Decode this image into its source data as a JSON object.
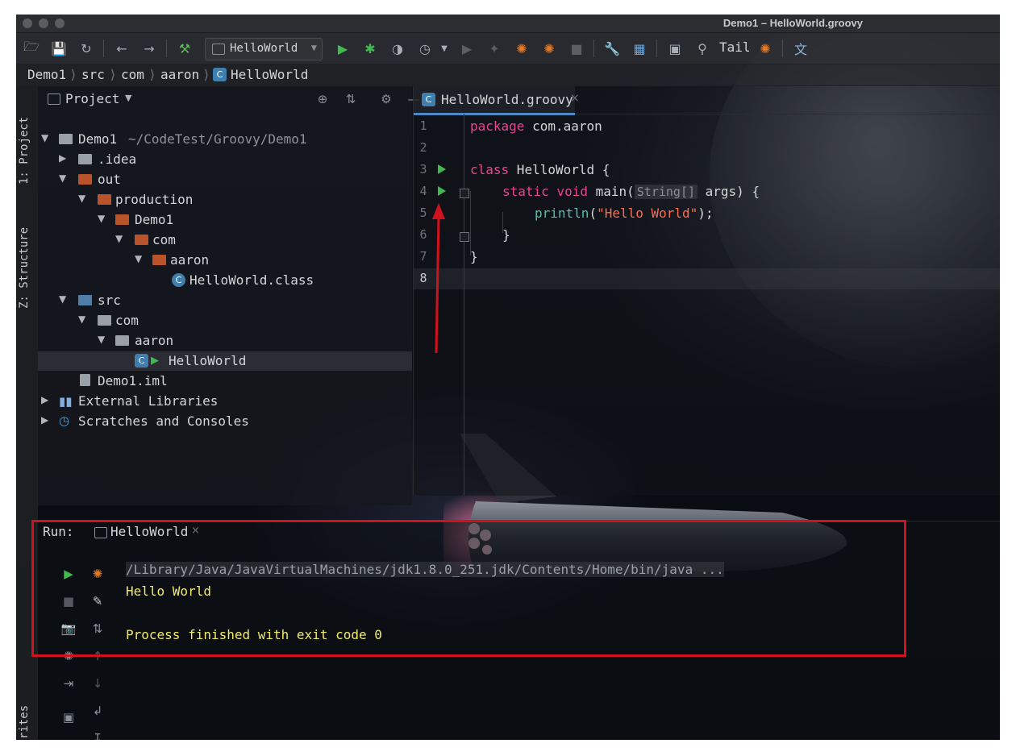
{
  "window": {
    "title": "Demo1 – HelloWorld.groovy"
  },
  "toolbar": {
    "run_config": "HelloWorld",
    "tail_label": "Tail",
    "icons": [
      "open-icon",
      "save-icon",
      "sync-icon",
      "back-icon",
      "forward-icon",
      "build-icon",
      "run-icon",
      "debug-icon",
      "coverage-icon",
      "profile-icon",
      "run-dropdown-icon",
      "resume-icon",
      "attach-icon",
      "bug-icon",
      "bug2-icon",
      "stop-icon",
      "settings-wrench-icon",
      "project-structure-icon",
      "terminal-icon",
      "search-icon",
      "tail-icon",
      "translate-icon"
    ]
  },
  "breadcrumb": {
    "items": [
      "Demo1",
      "src",
      "com",
      "aaron",
      "HelloWorld"
    ]
  },
  "left_strip": {
    "tab1": "1: Project",
    "tab2": "Z: Structure",
    "tab3": "rites"
  },
  "project": {
    "title": "Project",
    "tree": [
      {
        "label": "Demo1",
        "path": "~/CodeTest/Groovy/Demo1"
      },
      {
        "label": ".idea"
      },
      {
        "label": "out"
      },
      {
        "label": "production"
      },
      {
        "label": "Demo1"
      },
      {
        "label": "com"
      },
      {
        "label": "aaron"
      },
      {
        "label": "HelloWorld.class"
      },
      {
        "label": "src"
      },
      {
        "label": "com"
      },
      {
        "label": "aaron"
      },
      {
        "label": "HelloWorld"
      },
      {
        "label": "Demo1.iml"
      },
      {
        "label": "External Libraries"
      },
      {
        "label": "Scratches and Consoles"
      }
    ]
  },
  "editor": {
    "tab": "HelloWorld.groovy",
    "line_numbers": [
      "1",
      "2",
      "3",
      "4",
      "5",
      "6",
      "7",
      "8"
    ],
    "code": {
      "l1_kw": "package",
      "l1_rest": " com.aaron",
      "l3_kw": "class",
      "l3_rest": " HelloWorld {",
      "l4_kw": "static void",
      "l4_fn": " main(",
      "l4_hint": "String[]",
      "l4_rest": " args) {",
      "l5_fn": "println",
      "l5_open": "(",
      "l5_str": "\"Hello World\"",
      "l5_close": ");",
      "l6": "}",
      "l7": "}"
    }
  },
  "run": {
    "label": "Run:",
    "tab": "HelloWorld",
    "console": {
      "path": "/Library/Java/JavaVirtualMachines/jdk1.8.0_251.jdk/Contents/Home/bin/java ...",
      "output": "Hello World",
      "exit": "Process finished with exit code 0"
    }
  },
  "colors": {
    "keyword": "#e8458f",
    "function": "#57c0a3",
    "string": "#ff6b50",
    "console_output": "#f2ea6a",
    "annotation_red": "#d0121e",
    "run_green": "#3fb950"
  }
}
